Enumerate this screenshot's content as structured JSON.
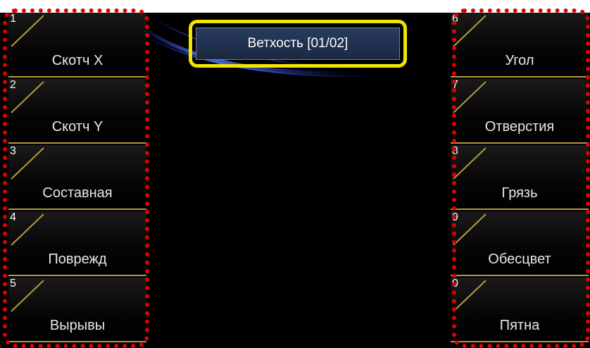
{
  "header": {
    "title": "Ветхость [01/02]"
  },
  "left_keys": [
    {
      "num": "1",
      "label": "Скотч X"
    },
    {
      "num": "2",
      "label": "Скотч Y"
    },
    {
      "num": "3",
      "label": "Составная"
    },
    {
      "num": "4",
      "label": "Поврежд"
    },
    {
      "num": "5",
      "label": "Вырывы"
    }
  ],
  "right_keys": [
    {
      "num": "6",
      "label": "Угол"
    },
    {
      "num": "7",
      "label": "Отверстия"
    },
    {
      "num": "8",
      "label": "Грязь"
    },
    {
      "num": "9",
      "label": "Обесцвет"
    },
    {
      "num": "0",
      "label": "Пятна"
    }
  ],
  "colors": {
    "highlight": "#f2e600",
    "annotation": "#e00000",
    "separator": "#b69a3a"
  }
}
